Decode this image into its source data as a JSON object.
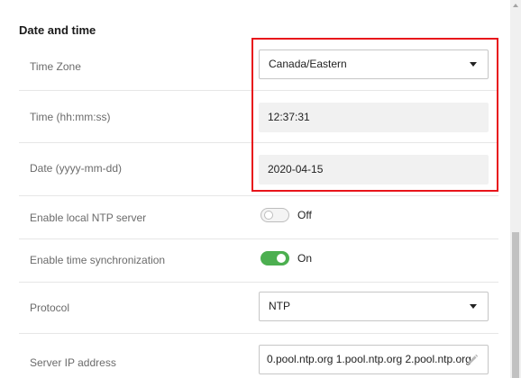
{
  "section": {
    "title": "Date and time"
  },
  "rows": {
    "timezone": {
      "label": "Time Zone",
      "value": "Canada/Eastern"
    },
    "time": {
      "label": "Time (hh:mm:ss)",
      "value": "12:37:31"
    },
    "date": {
      "label": "Date (yyyy-mm-dd)",
      "value": "2020-04-15"
    },
    "local_ntp": {
      "label": "Enable local NTP server",
      "state": "Off",
      "enabled": false
    },
    "time_sync": {
      "label": "Enable time synchronization",
      "state": "On",
      "enabled": true
    },
    "protocol": {
      "label": "Protocol",
      "value": "NTP"
    },
    "server_ip": {
      "label": "Server IP address",
      "value": "0.pool.ntp.org 1.pool.ntp.org 2.pool.ntp.org"
    }
  },
  "colors": {
    "highlight": "#e8141b",
    "toggle_on": "#4caf50",
    "label_text": "#6b6b6b"
  },
  "icons": {
    "select_caret": "caret-down-icon",
    "edit": "pencil-icon",
    "scroll_up": "scroll-up-arrow-icon"
  }
}
